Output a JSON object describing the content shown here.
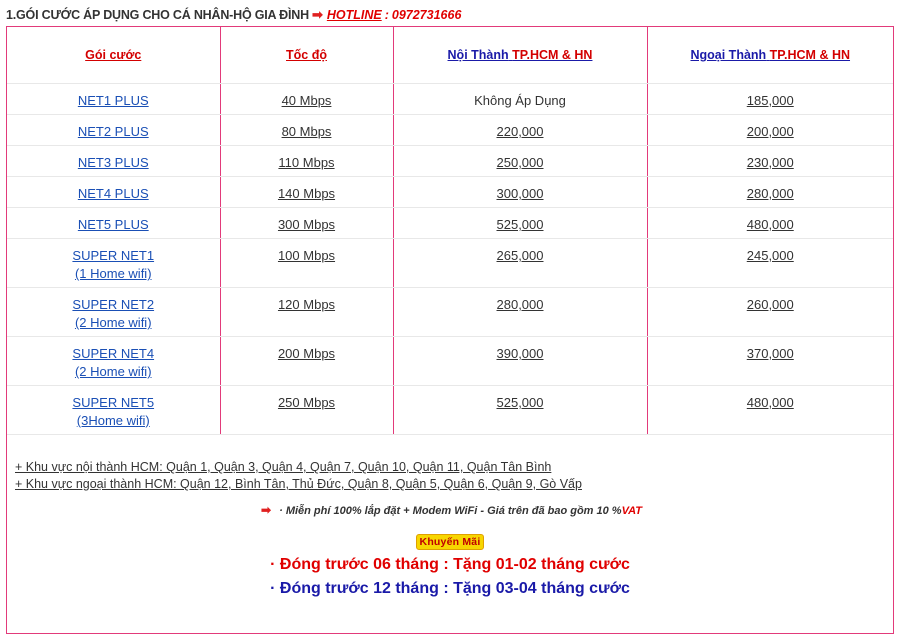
{
  "header": {
    "title": "1.GÓI CƯỚC ÁP DỤNG CHO CÁ NHÂN-HỘ GIA ĐÌNH",
    "arrow": "➡",
    "hotline_label": "HOTLINE",
    "hotline_sep": ":",
    "hotline_number": "0972731666"
  },
  "table": {
    "headers": {
      "package": "Gói cước",
      "speed": "Tốc độ",
      "inner_prefix": "Nội Thành",
      "inner_city": "TP.HCM & HN",
      "outer_prefix": "Ngoại Thành",
      "outer_city": "TP.HCM & HN"
    },
    "rows": [
      {
        "name": "NET1 PLUS",
        "sub": "",
        "speed": "40  Mbps",
        "inner": "Không Áp Dụng",
        "outer": "185,000"
      },
      {
        "name": "NET2 PLUS",
        "sub": "",
        "speed": "80  Mbps",
        "inner": "220,000",
        "outer": "200,000"
      },
      {
        "name": "NET3 PLUS",
        "sub": "",
        "speed": "110  Mbps",
        "inner": "250,000",
        "outer": "230,000"
      },
      {
        "name": "NET4 PLUS",
        "sub": "",
        "speed": "140  Mbps",
        "inner": "300,000",
        "outer": "280,000"
      },
      {
        "name": "NET5 PLUS",
        "sub": "",
        "speed": "300  Mbps",
        "inner": "525,000",
        "outer": "480,000"
      },
      {
        "name": "SUPER NET1",
        "sub": "(1 Home wifi)",
        "speed": "100  Mbps",
        "inner": "265,000",
        "outer": "245,000"
      },
      {
        "name": "SUPER NET2",
        "sub": "(2 Home wifi)",
        "speed": "120  Mbps",
        "inner": "280,000",
        "outer": "260,000"
      },
      {
        "name": "SUPER NET4",
        "sub": "(2 Home wifi)",
        "speed": "200  Mbps",
        "inner": "390,000",
        "outer": "370,000"
      },
      {
        "name": "SUPER NET5 ",
        "sub": "(3Home wifi)",
        "speed": "250  Mbps",
        "inner": "525,000",
        "outer": "480,000"
      }
    ]
  },
  "areas": {
    "inner": " + Khu vực nội thành HCM: Quận 1, Quận 3, Quận 4, Quận 7, Quận 10, Quận 11, Quận Tân Bình",
    "outer": " + Khu vực ngoại thành HCM: Quận 12, Bình Tân, Thủ Đức, Quận 8, Quận 5, Quận 6, Quận 9, Gò Vấp"
  },
  "note": {
    "arrow": "➡",
    "text": "· Miễn phí 100% lắp đặt + Modem WiFi - Giá trên đã bao gồm 10 %",
    "vat": "VAT"
  },
  "promo": {
    "badge": "Khuyến Mãi",
    "line1": "· Đóng trước 06 tháng : Tặng 01-02 tháng cước",
    "line2": "· Đóng trước 12 tháng : Tặng 03-04 tháng cước"
  },
  "colors": {
    "border": "#e23a7a",
    "red": "#e00000",
    "blue": "#1a1aa8",
    "link": "#1a4fb5",
    "badge_bg": "#f7d600"
  }
}
